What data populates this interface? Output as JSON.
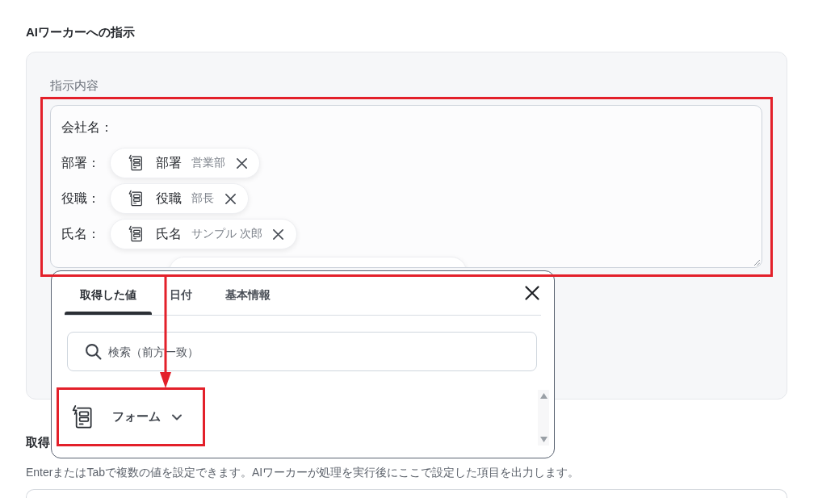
{
  "section_title": "AIワーカーへの指示",
  "instruction": {
    "label": "指示内容",
    "highlighted": true,
    "lines": [
      {
        "kind": "text",
        "label": "会社名："
      },
      {
        "kind": "chip",
        "label": "部署：",
        "chip": {
          "name": "部署",
          "value": "営業部"
        }
      },
      {
        "kind": "chip",
        "label": "役職：",
        "chip": {
          "name": "役職",
          "value": "部長"
        }
      },
      {
        "kind": "chip",
        "label": "氏名：",
        "chip": {
          "name": "氏名",
          "value": "サンプル 次郎"
        }
      },
      {
        "kind": "cut_off"
      }
    ]
  },
  "value_picker": {
    "tabs": [
      {
        "label": "取得した値",
        "selected": true
      },
      {
        "label": "日付",
        "selected": false
      },
      {
        "label": "基本情報",
        "selected": false
      }
    ],
    "search": {
      "placeholder": "検索（前方一致）"
    },
    "items": [
      {
        "label": "フォーム",
        "expanded": false,
        "highlighted": true
      }
    ]
  },
  "annotation_arrow": true,
  "output_section": {
    "title": "取得",
    "hint": "EnterまたはTabで複数の値を設定できます。AIワーカーが処理を実行後にここで設定した項目を出力します。"
  }
}
